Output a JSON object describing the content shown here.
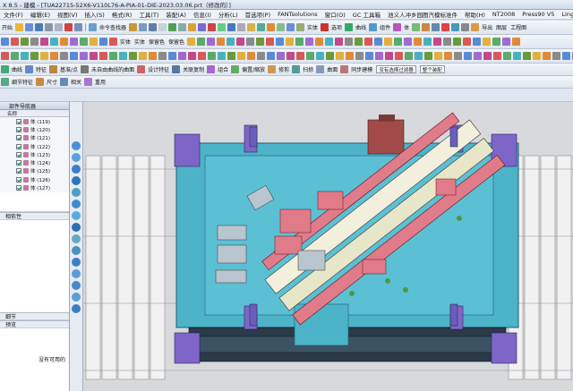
{
  "window": {
    "title": "X 8.5 - 建模 - [TUA22715-52X6-V110L76-A-PIA-01-DIE-2023.03.06.prt（修改的）]"
  },
  "menu": [
    "文件(F)",
    "编辑(E)",
    "视图(V)",
    "插入(S)",
    "格式(R)",
    "工具(T)",
    "装配(A)",
    "信息(I)",
    "分析(L)",
    "首选项(P)",
    "FANTsolutions",
    "窗口(O)",
    "GC 工具箱",
    "池义人冲乡园图汽模标准件",
    "帮助(H)",
    "NT2008",
    "Press90 V5",
    "Lingress_V2.9 X5",
    "超凡标准件"
  ],
  "toolbar1": {
    "start": "开始",
    "cmd": "命令查找器",
    "fit": "实体",
    "select": "选项",
    "line": "曲线",
    "assembly": "组件",
    "body": "体",
    "export": "导出",
    "layer": "图层",
    "engineering": "工程图"
  },
  "toolbar2": {
    "b1": "实体",
    "b2": "实体",
    "b3": "保留色",
    "b4": "保留色"
  },
  "toolbar3": {
    "curve": "曲线",
    "feature": "特征",
    "datum": "基准/点",
    "block": "未自由曲线的曲面",
    "design": "设计特征",
    "assoc": "关联复制",
    "combine": "组合",
    "offset": "偏置/缩放",
    "trim": "修剪",
    "sweep": "扫掠",
    "surface": "曲面",
    "sync": "同步建模",
    "filter": "没有选择过滤器",
    "scope": "整个装配"
  },
  "toolbar4": {
    "detail": "细节特征",
    "dim": "尺寸",
    "related": "相关",
    "reuse": "重用"
  },
  "navigator": {
    "title": "部件导航器",
    "col_name": "名称",
    "rows": [
      "体 (119)",
      "体 (120)",
      "体 (121)",
      "体 (122)",
      "体 (123)",
      "体 (124)",
      "体 (125)",
      "体 (126)",
      "体 (127)"
    ],
    "dependency": "相依性",
    "detail": "细节",
    "preview": "预览",
    "no_preview": "没有可用的"
  },
  "colors": {
    "plate": "#4db3c9",
    "part": "#e07b8a",
    "clamp": "#7e66c9",
    "base": "#2a3a48"
  }
}
